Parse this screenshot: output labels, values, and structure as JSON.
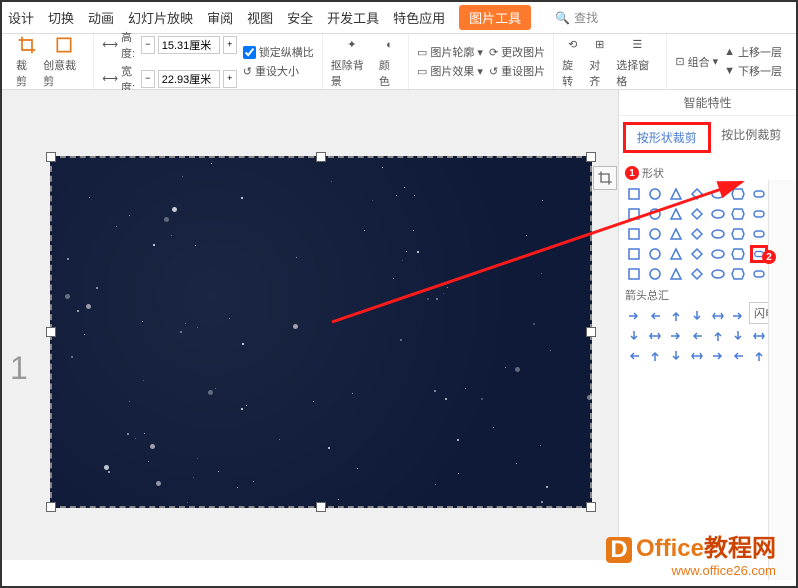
{
  "tabs": [
    "设计",
    "切换",
    "动画",
    "幻灯片放映",
    "审阅",
    "视图",
    "安全",
    "开发工具",
    "特色应用",
    "图片工具"
  ],
  "active_tab_index": 7,
  "contextual_tab_index": 9,
  "search_label": "查找",
  "ribbon": {
    "crop": "裁剪",
    "creative_crop": "创意裁剪",
    "height_label": "高度:",
    "height_value": "15.31厘米",
    "width_label": "宽度:",
    "width_value": "22.93厘米",
    "lock_ratio": "锁定纵横比",
    "reset_size": "重设大小",
    "remove_bg": "抠除背景",
    "color": "颜色",
    "pic_outline": "图片轮廓",
    "pic_effects": "图片效果",
    "change_pic": "更改图片",
    "reset_pic": "重设图片",
    "rotate": "旋转",
    "align": "对齐",
    "group": "组合",
    "selection_pane": "选择窗格",
    "bring_forward": "上移一层",
    "send_backward": "下移一层"
  },
  "slide_number": "1",
  "side": {
    "panel_title": "智能特性",
    "crop_by_shape": "按形状裁剪",
    "crop_by_ratio": "按比例裁剪",
    "basic_shapes": "形状",
    "arrows": "箭头总汇",
    "tooltip": "闪电形"
  },
  "markers": {
    "one": "1",
    "two": "2"
  },
  "watermark": {
    "title_a": "Office",
    "title_b": "教程网",
    "url": "www.office26.com",
    "icon": "D"
  }
}
